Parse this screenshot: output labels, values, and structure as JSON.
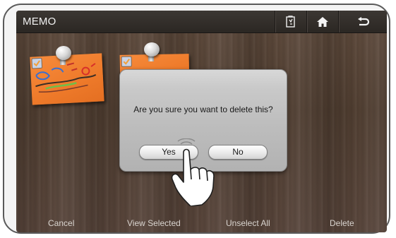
{
  "app": {
    "title": "MEMO"
  },
  "titlebar": {
    "buttons": [
      {
        "icon": "memo-edit-icon"
      },
      {
        "icon": "home-icon"
      },
      {
        "icon": "back-icon"
      }
    ]
  },
  "dialog": {
    "message": "Are you sure you want to delete this?",
    "yes_label": "Yes",
    "no_label": "No"
  },
  "actions": {
    "cancel": "Cancel",
    "view_selected": "View Selected",
    "unselect_all": "Unselect All",
    "delete": "Delete"
  },
  "memos": [
    {
      "checked": true
    },
    {
      "checked": true
    }
  ],
  "colors": {
    "note_orange": "#f07f2e",
    "titlebar": "#2f2a26",
    "dialog": "#c4c4c4"
  }
}
